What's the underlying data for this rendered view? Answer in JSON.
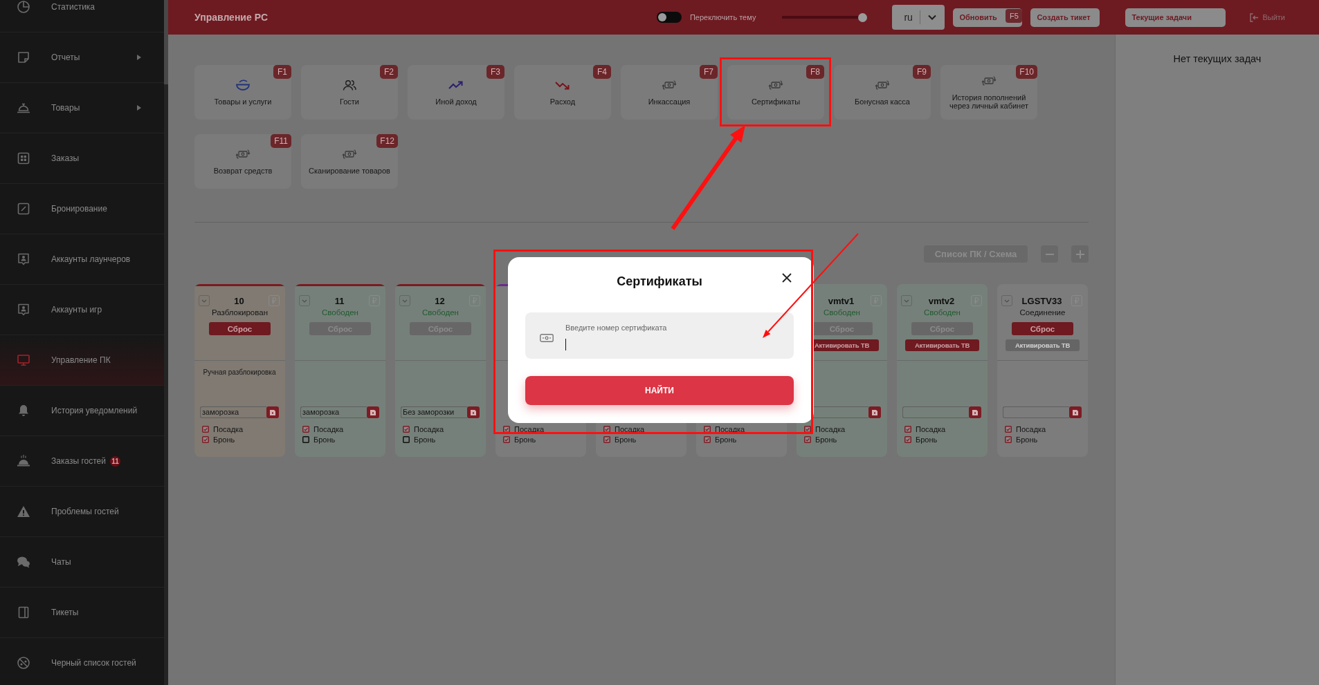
{
  "sidebar": {
    "items": [
      {
        "label": "Статистика",
        "submenu": false,
        "selected": false
      },
      {
        "label": "Отчеты",
        "submenu": true,
        "selected": false
      },
      {
        "label": "Товары",
        "submenu": true,
        "selected": false
      },
      {
        "label": "Заказы",
        "submenu": false,
        "selected": false
      },
      {
        "label": "Бронирование",
        "submenu": false,
        "selected": false
      },
      {
        "label": "Аккаунты лаунчеров",
        "submenu": false,
        "selected": false
      },
      {
        "label": "Аккаунты игр",
        "submenu": false,
        "selected": false
      },
      {
        "label": "Управление ПК",
        "submenu": false,
        "selected": true
      },
      {
        "label": "История уведомлений",
        "submenu": false,
        "selected": false
      },
      {
        "label": "Заказы гостей",
        "badge": "11",
        "submenu": false,
        "selected": false
      },
      {
        "label": "Проблемы гостей",
        "submenu": false,
        "selected": false
      },
      {
        "label": "Чаты",
        "submenu": false,
        "selected": false
      },
      {
        "label": "Тикеты",
        "submenu": false,
        "selected": false
      },
      {
        "label": "Черный список гостей",
        "submenu": false,
        "selected": false
      }
    ]
  },
  "topbar": {
    "title": "Управление PC",
    "theme_toggle": {
      "label": "Переключить тему",
      "on": false
    },
    "slider": {
      "level": 1
    },
    "language": {
      "value": "ru"
    },
    "buttons": [
      {
        "label": "Обновить",
        "hotkey": "F5"
      },
      {
        "label": "Создать тикет"
      }
    ],
    "tasks_button": {
      "label": "Текущие задачи"
    },
    "logout": {
      "label": "Выйти"
    }
  },
  "actions": [
    {
      "label": "Товары и услуги",
      "hotkey": "F1"
    },
    {
      "label": "Гости",
      "hotkey": "F2"
    },
    {
      "label": "Иной доход",
      "hotkey": "F3"
    },
    {
      "label": "Расход",
      "hotkey": "F4"
    },
    {
      "label": "Инкассация",
      "hotkey": "F7"
    },
    {
      "label": "Сертификаты",
      "hotkey": "F8"
    },
    {
      "label": "Бонусная касса",
      "hotkey": "F9"
    },
    {
      "label": "История пополнений через личный кабинет",
      "hotkey": "F10"
    },
    {
      "label": "Возврат средств",
      "hotkey": "F11"
    },
    {
      "label": "Сканирование товаров",
      "hotkey": "F12"
    }
  ],
  "pc_panel": {
    "view_button": "Список ПК / Схема",
    "cards": [
      {
        "name": "10",
        "status": "Разблокирован",
        "kind": "unlocked",
        "color": "#7c1a20",
        "reset": {
          "label": "Сброс",
          "disabled": false
        },
        "note": "Ручная разблокировка",
        "freeze_value": "заморозка",
        "checks": [
          {
            "label": "Посадка",
            "checked": true
          },
          {
            "label": "Бронь",
            "checked": true
          }
        ]
      },
      {
        "name": "11",
        "status": "Свободен",
        "kind": "free",
        "color": "#7c1a20",
        "reset": {
          "label": "Сброс",
          "disabled": true
        },
        "freeze_value": "заморозка",
        "checks": [
          {
            "label": "Посадка",
            "checked": true
          },
          {
            "label": "Бронь",
            "checked": false
          }
        ]
      },
      {
        "name": "12",
        "status": "Свободен",
        "kind": "free",
        "color": "#7c1a20",
        "reset": {
          "label": "Сброс",
          "disabled": true
        },
        "freeze_value": "Без заморозки",
        "checks": [
          {
            "label": "Посадка",
            "checked": true
          },
          {
            "label": "Бронь",
            "checked": false
          }
        ]
      },
      {
        "kind": "idle",
        "color": "#6b2a8c",
        "checks": [
          {
            "label": "Посадка",
            "checked": true
          },
          {
            "label": "Бронь",
            "checked": true
          }
        ]
      },
      {
        "kind": "idle",
        "checks": [
          {
            "label": "Посадка",
            "checked": true
          },
          {
            "label": "Бронь",
            "checked": true
          }
        ]
      },
      {
        "kind": "idle",
        "checks": [
          {
            "label": "Посадка",
            "checked": true
          },
          {
            "label": "Бронь",
            "checked": true
          }
        ]
      },
      {
        "name": "vmtv1",
        "status": "Свободен",
        "kind": "free",
        "reset": {
          "label": "Сброс",
          "disabled": true
        },
        "tv_button": {
          "label": "Активировать ТВ",
          "disabled": false
        },
        "checks": [
          {
            "label": "Посадка",
            "checked": true
          },
          {
            "label": "Бронь",
            "checked": true
          }
        ]
      },
      {
        "name": "vmtv2",
        "status": "Свободен",
        "kind": "free",
        "reset": {
          "label": "Сброс",
          "disabled": true
        },
        "tv_button": {
          "label": "Активировать ТВ",
          "disabled": false
        },
        "checks": [
          {
            "label": "Посадка",
            "checked": true
          },
          {
            "label": "Бронь",
            "checked": true
          }
        ]
      },
      {
        "name": "LGSTV33",
        "status": "Соединение",
        "kind": "idle",
        "reset": {
          "label": "Сброс",
          "disabled": false
        },
        "tv_button": {
          "label": "Активировать ТВ",
          "disabled": true
        },
        "checks": [
          {
            "label": "Посадка",
            "checked": true
          },
          {
            "label": "Бронь",
            "checked": true
          }
        ]
      }
    ]
  },
  "tasks_panel": {
    "empty_text": "Нет текущих задач"
  },
  "modal": {
    "title": "Сертификаты",
    "field": {
      "label": "Введите номер сертификата",
      "focused": true
    },
    "submit": "НАЙТИ"
  }
}
